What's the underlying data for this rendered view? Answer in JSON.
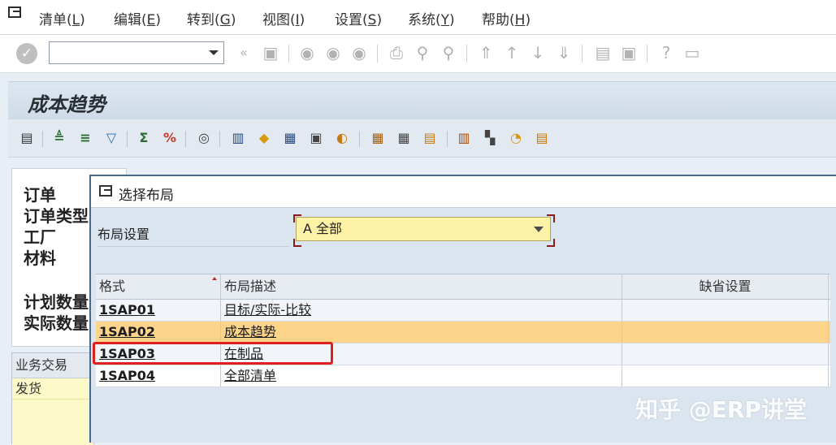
{
  "menu": {
    "items": [
      {
        "label": "清单(",
        "key": "L",
        "end": ")"
      },
      {
        "label": "编辑(",
        "key": "E",
        "end": ")"
      },
      {
        "label": "转到(",
        "key": "G",
        "end": ")"
      },
      {
        "label": "视图(",
        "key": "I",
        "end": ")"
      },
      {
        "label": "设置(",
        "key": "S",
        "end": ")"
      },
      {
        "label": "系统(",
        "key": "Y",
        "end": ")"
      },
      {
        "label": "帮助(",
        "key": "H",
        "end": ")"
      }
    ]
  },
  "std_toolbar": {
    "command_value": "",
    "ok_icon": "check-icon"
  },
  "page": {
    "title": "成本趋势"
  },
  "form": {
    "labels": [
      "订单",
      "订单类型",
      "工厂",
      "材料",
      "计划数量",
      "实际数量"
    ]
  },
  "bg_table": {
    "header": "业务交易",
    "rows": [
      "发货"
    ]
  },
  "dialog": {
    "title": "选择布局",
    "layout_setting_label": "布局设置",
    "layout_setting_value": "A 全部",
    "columns": [
      "格式",
      "布局描述",
      "缺省设置"
    ],
    "rows": [
      {
        "format": "1SAP01",
        "description": "目标/实际-比较",
        "default": ""
      },
      {
        "format": "1SAP02",
        "description": "成本趋势",
        "default": ""
      },
      {
        "format": "1SAP03",
        "description": "在制品",
        "default": ""
      },
      {
        "format": "1SAP04",
        "description": "全部清单",
        "default": ""
      }
    ],
    "selected_row": 1,
    "highlight_color": "#e02020"
  },
  "watermark": "知乎 @ERP讲堂"
}
